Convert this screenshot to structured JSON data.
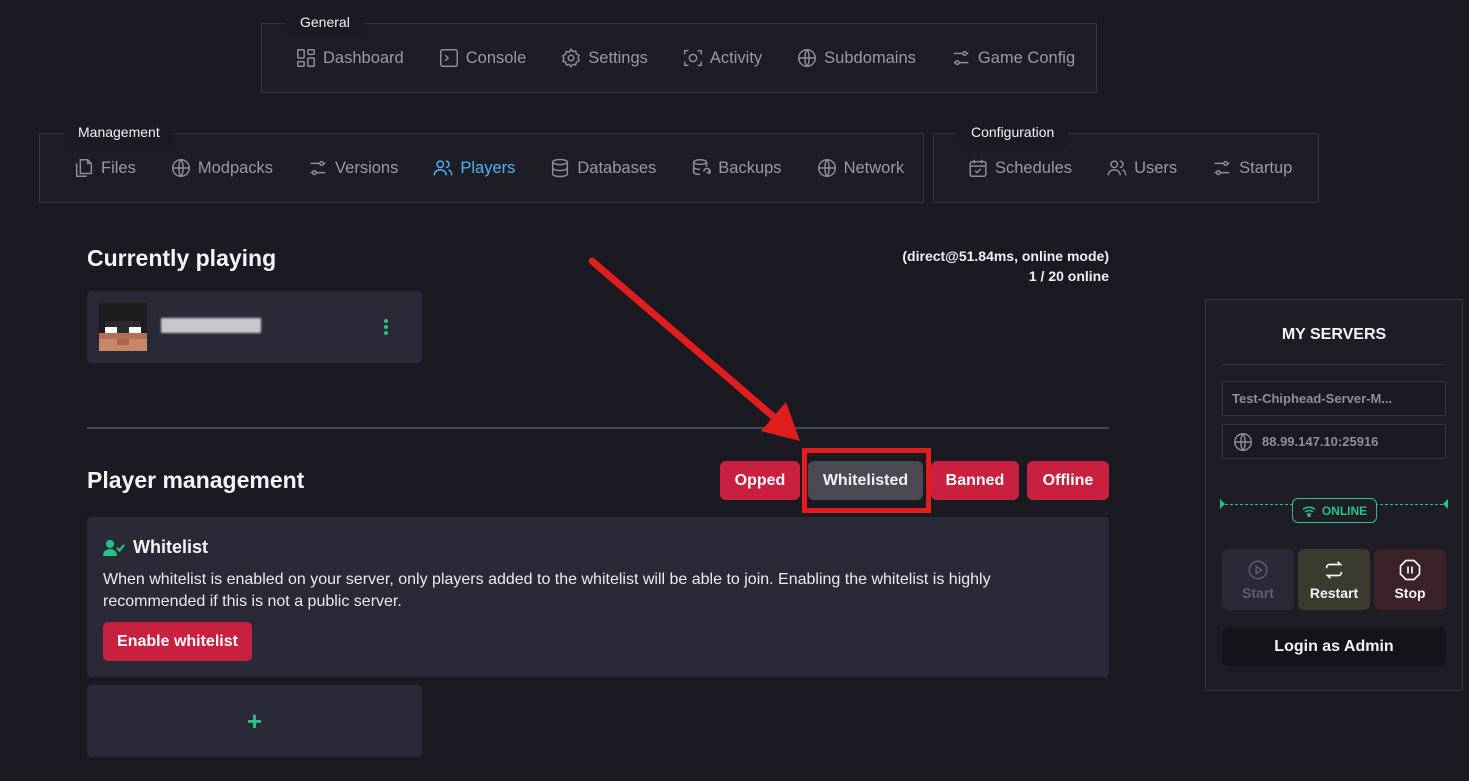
{
  "nav": {
    "general": {
      "title": "General",
      "items": [
        {
          "label": "Dashboard",
          "icon": "dashboard-icon"
        },
        {
          "label": "Console",
          "icon": "console-icon"
        },
        {
          "label": "Settings",
          "icon": "gear-icon"
        },
        {
          "label": "Activity",
          "icon": "activity-icon"
        },
        {
          "label": "Subdomains",
          "icon": "globe-icon"
        },
        {
          "label": "Game Config",
          "icon": "sliders-icon"
        }
      ]
    },
    "management": {
      "title": "Management",
      "items": [
        {
          "label": "Files",
          "icon": "files-icon"
        },
        {
          "label": "Modpacks",
          "icon": "globe-icon"
        },
        {
          "label": "Versions",
          "icon": "sliders-icon"
        },
        {
          "label": "Players",
          "icon": "users-icon",
          "active": true
        },
        {
          "label": "Databases",
          "icon": "database-icon"
        },
        {
          "label": "Backups",
          "icon": "backup-icon"
        },
        {
          "label": "Network",
          "icon": "globe-icon"
        }
      ]
    },
    "configuration": {
      "title": "Configuration",
      "items": [
        {
          "label": "Schedules",
          "icon": "calendar-icon"
        },
        {
          "label": "Users",
          "icon": "users-icon"
        },
        {
          "label": "Startup",
          "icon": "sliders-icon"
        }
      ]
    }
  },
  "currently_playing": {
    "title": "Currently playing",
    "connection": "(direct@51.84ms, online mode)",
    "online_count": "1 / 20 online",
    "player": {
      "name": "",
      "avatar": "player-skin-avatar"
    }
  },
  "player_management": {
    "title": "Player management",
    "tabs": [
      {
        "label": "Opped"
      },
      {
        "label": "Whitelisted",
        "selected": true
      },
      {
        "label": "Banned"
      },
      {
        "label": "Offline"
      }
    ],
    "whitelist": {
      "title": "Whitelist",
      "description": "When whitelist is enabled on your server, only players added to the whitelist will be able to join. Enabling the whitelist is highly recommended if this is not a public server.",
      "enable_button": "Enable whitelist"
    },
    "add_label": "+"
  },
  "sidebar": {
    "title": "MY SERVERS",
    "server_name": "Test-Chiphead-Server-M...",
    "server_address": "88.99.147.10:25916",
    "status": "ONLINE",
    "buttons": {
      "start": "Start",
      "restart": "Restart",
      "stop": "Stop"
    },
    "admin_button": "Login as Admin"
  },
  "colors": {
    "accent_red": "#c8203e",
    "active_blue": "#4ab3f4",
    "online_green": "#26c281",
    "annotation_red": "#e21d1d"
  }
}
